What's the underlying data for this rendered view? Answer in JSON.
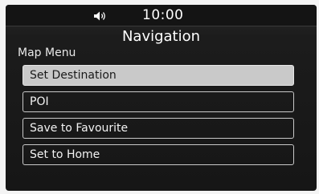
{
  "status": {
    "time": "10:00",
    "volume_icon": "speaker-volume-icon"
  },
  "header": {
    "title": "Navigation"
  },
  "menu": {
    "section_label": "Map Menu",
    "items": [
      {
        "label": "Set Destination",
        "selected": true
      },
      {
        "label": "POI",
        "selected": false
      },
      {
        "label": "Save to Favourite",
        "selected": false
      },
      {
        "label": "Set to Home",
        "selected": false
      }
    ]
  },
  "colors": {
    "background": "#1c1c1c",
    "selected_fill": "#c9c9c9",
    "item_border": "#c8c8c8"
  }
}
